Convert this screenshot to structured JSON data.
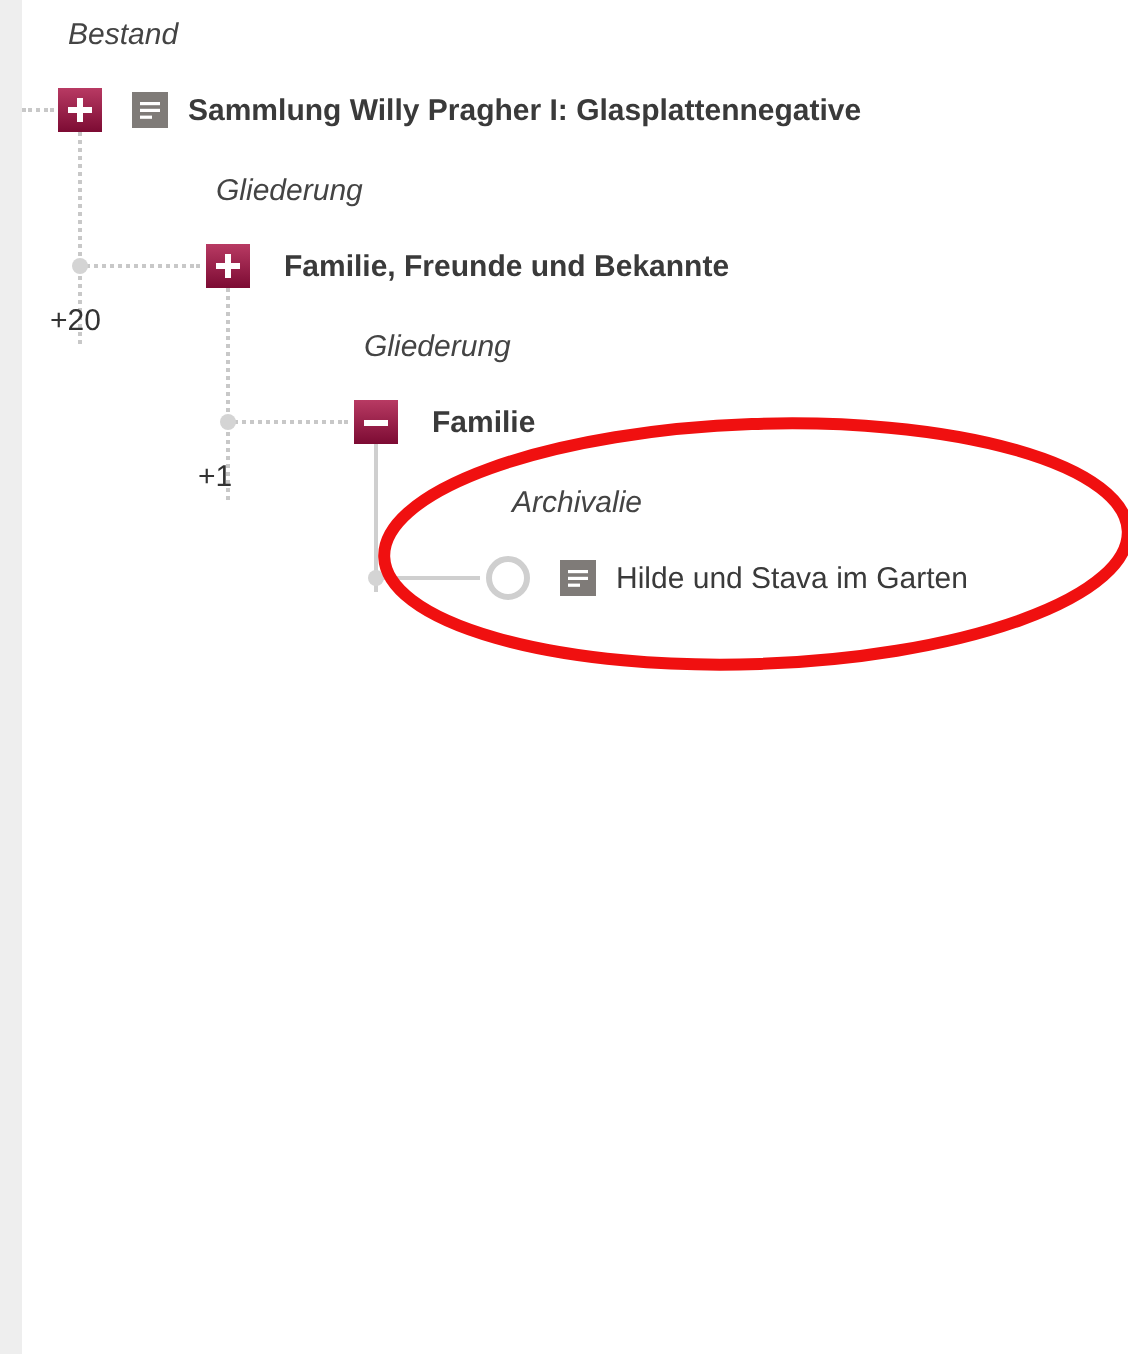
{
  "tree": [
    {
      "kind": "group",
      "level_label": "Bestand",
      "title": "Sammlung Willy Pragher I: Glasplattennegative",
      "expanded": false,
      "document_icon": true,
      "children": [
        {
          "kind": "group",
          "level_label": "Gliederung",
          "title": "Familie, Freunde und Bekannte",
          "expanded": false,
          "document_icon": false,
          "count": "+20",
          "children": [
            {
              "kind": "group",
              "level_label": "Gliederung",
              "title": "Familie",
              "expanded": true,
              "document_icon": false,
              "count": "+1",
              "children": [
                {
                  "kind": "leaf",
                  "level_label": "Archivalie",
                  "title": "Hilde und Stava im Garten",
                  "document_icon": true
                }
              ]
            }
          ]
        }
      ]
    }
  ]
}
